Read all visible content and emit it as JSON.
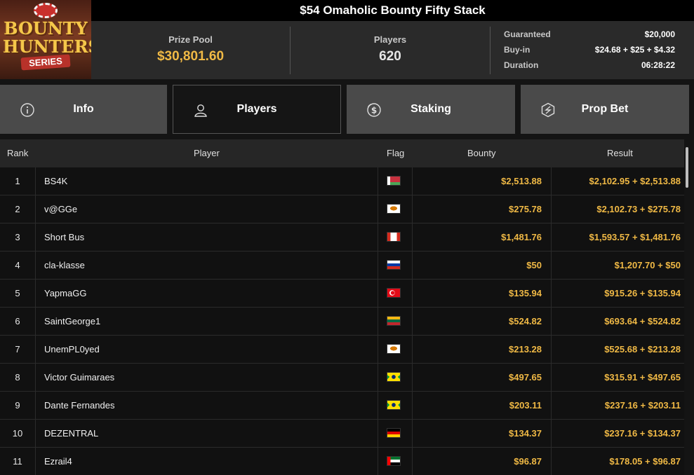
{
  "header": {
    "logo_text": [
      "BOUNTY",
      "HUNTERS",
      "SERIES"
    ],
    "title": "$54 Omaholic Bounty Fifty Stack",
    "prize_pool_label": "Prize Pool",
    "prize_pool_value": "$30,801.60",
    "players_label": "Players",
    "players_value": "620",
    "details": [
      {
        "key": "Guaranteed",
        "value": "$20,000"
      },
      {
        "key": "Buy-in",
        "value": "$24.68 + $25 + $4.32"
      },
      {
        "key": "Duration",
        "value": "06:28:22"
      }
    ]
  },
  "tabs": [
    {
      "label": "Info",
      "icon": "info-icon",
      "active": false
    },
    {
      "label": "Players",
      "icon": "user-icon",
      "active": true
    },
    {
      "label": "Staking",
      "icon": "dollar-coin-icon",
      "active": false
    },
    {
      "label": "Prop Bet",
      "icon": "prop-bet-icon",
      "active": false
    }
  ],
  "table": {
    "columns": {
      "rank": "Rank",
      "player": "Player",
      "flag": "Flag",
      "bounty": "Bounty",
      "result": "Result"
    },
    "rows": [
      {
        "rank": "1",
        "player": "BS4K",
        "flag": "belarus",
        "bounty": "$2,513.88",
        "result": "$2,102.95 + $2,513.88"
      },
      {
        "rank": "2",
        "player": "v@GGe",
        "flag": "cyprus",
        "bounty": "$275.78",
        "result": "$2,102.73 + $275.78"
      },
      {
        "rank": "3",
        "player": "Short Bus",
        "flag": "canada",
        "bounty": "$1,481.76",
        "result": "$1,593.57 + $1,481.76"
      },
      {
        "rank": "4",
        "player": "cla-klasse",
        "flag": "russia",
        "bounty": "$50",
        "result": "$1,207.70 + $50"
      },
      {
        "rank": "5",
        "player": "YapmaGG",
        "flag": "turkey",
        "bounty": "$135.94",
        "result": "$915.26 + $135.94"
      },
      {
        "rank": "6",
        "player": "SaintGeorge1",
        "flag": "lithuania",
        "bounty": "$524.82",
        "result": "$693.64 + $524.82"
      },
      {
        "rank": "7",
        "player": "UnemPL0yed",
        "flag": "cyprus",
        "bounty": "$213.28",
        "result": "$525.68 + $213.28"
      },
      {
        "rank": "8",
        "player": "Victor Guimaraes",
        "flag": "brazil",
        "bounty": "$497.65",
        "result": "$315.91 + $497.65"
      },
      {
        "rank": "9",
        "player": "Dante Fernandes",
        "flag": "brazil",
        "bounty": "$203.11",
        "result": "$237.16 + $203.11"
      },
      {
        "rank": "10",
        "player": "DEZENTRAL",
        "flag": "germany",
        "bounty": "$134.37",
        "result": "$237.16 + $134.37"
      },
      {
        "rank": "11",
        "player": "Ezrail4",
        "flag": "uae",
        "bounty": "$96.87",
        "result": "$178.05 + $96.87"
      }
    ]
  },
  "colors": {
    "accent": "#f0b945",
    "tab_bg": "#4a4a4a",
    "tab_active_bg": "#151515",
    "row_bg": "#111111"
  }
}
